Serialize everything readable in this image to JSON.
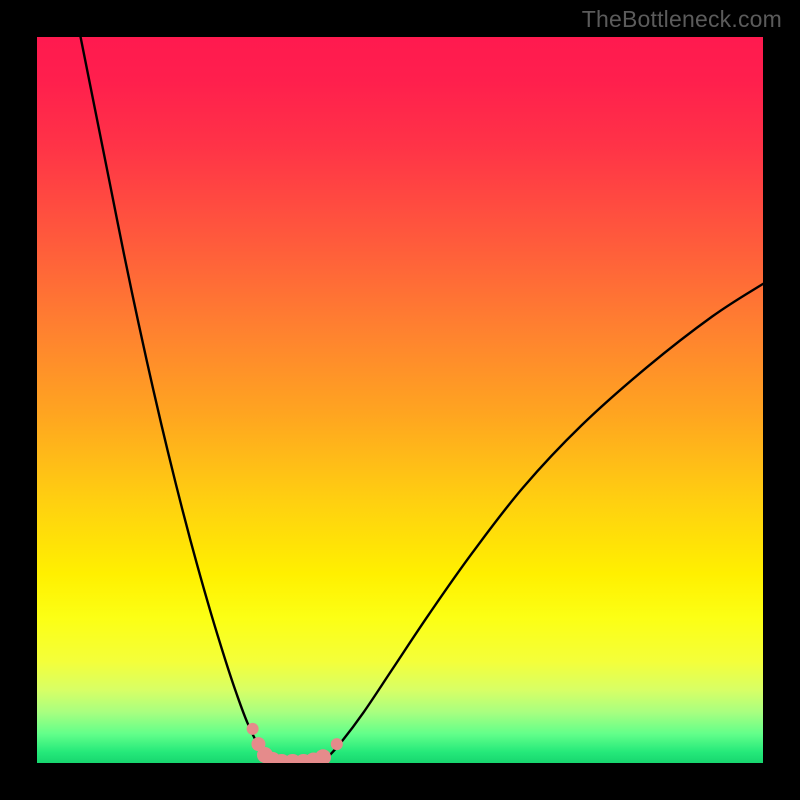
{
  "watermark": "TheBottleneck.com",
  "colors": {
    "gradient_stops": [
      {
        "offset": 0.0,
        "color": "#ff1a4f"
      },
      {
        "offset": 0.06,
        "color": "#ff1f4d"
      },
      {
        "offset": 0.15,
        "color": "#ff3347"
      },
      {
        "offset": 0.28,
        "color": "#ff5a3c"
      },
      {
        "offset": 0.4,
        "color": "#ff8030"
      },
      {
        "offset": 0.52,
        "color": "#ffa520"
      },
      {
        "offset": 0.64,
        "color": "#ffd010"
      },
      {
        "offset": 0.74,
        "color": "#fff000"
      },
      {
        "offset": 0.8,
        "color": "#fcff14"
      },
      {
        "offset": 0.86,
        "color": "#f4ff3a"
      },
      {
        "offset": 0.9,
        "color": "#d7ff66"
      },
      {
        "offset": 0.93,
        "color": "#a8ff80"
      },
      {
        "offset": 0.96,
        "color": "#62ff8a"
      },
      {
        "offset": 0.985,
        "color": "#25e97a"
      },
      {
        "offset": 1.0,
        "color": "#17d66f"
      }
    ],
    "curve": "#000000",
    "marker_fill": "#e58b8b",
    "marker_stroke": "#c96f6f"
  },
  "chart_data": {
    "type": "line",
    "title": "",
    "xlabel": "",
    "ylabel": "",
    "xlim": [
      0,
      100
    ],
    "ylim": [
      0,
      100
    ],
    "series": [
      {
        "name": "curve-left",
        "x": [
          6.0,
          8.0,
          10.0,
          12.0,
          14.0,
          16.0,
          18.0,
          20.0,
          22.0,
          24.0,
          26.0,
          27.5,
          29.0,
          30.5,
          32.0,
          33.0
        ],
        "y": [
          100.0,
          90.0,
          80.0,
          70.0,
          60.5,
          51.5,
          43.0,
          35.0,
          27.5,
          20.5,
          14.0,
          9.5,
          5.5,
          2.5,
          0.8,
          0.0
        ]
      },
      {
        "name": "curve-right",
        "x": [
          38.5,
          40.0,
          42.0,
          45.0,
          49.0,
          54.0,
          60.0,
          67.0,
          75.0,
          84.0,
          93.0,
          100.0
        ],
        "y": [
          0.0,
          0.8,
          3.0,
          7.0,
          13.0,
          20.5,
          29.0,
          38.0,
          46.5,
          54.5,
          61.5,
          66.0
        ]
      },
      {
        "name": "floor",
        "x": [
          33.0,
          38.5
        ],
        "y": [
          0.0,
          0.0
        ]
      }
    ],
    "markers": {
      "name": "highlight-points",
      "points": [
        {
          "x": 29.7,
          "y": 4.7,
          "r": 6
        },
        {
          "x": 30.5,
          "y": 2.6,
          "r": 7
        },
        {
          "x": 31.4,
          "y": 1.1,
          "r": 8
        },
        {
          "x": 32.4,
          "y": 0.3,
          "r": 9
        },
        {
          "x": 33.7,
          "y": 0.0,
          "r": 9
        },
        {
          "x": 35.2,
          "y": 0.0,
          "r": 9
        },
        {
          "x": 36.7,
          "y": 0.0,
          "r": 9
        },
        {
          "x": 38.1,
          "y": 0.2,
          "r": 9
        },
        {
          "x": 39.4,
          "y": 0.8,
          "r": 8
        },
        {
          "x": 41.3,
          "y": 2.6,
          "r": 6
        }
      ]
    }
  }
}
